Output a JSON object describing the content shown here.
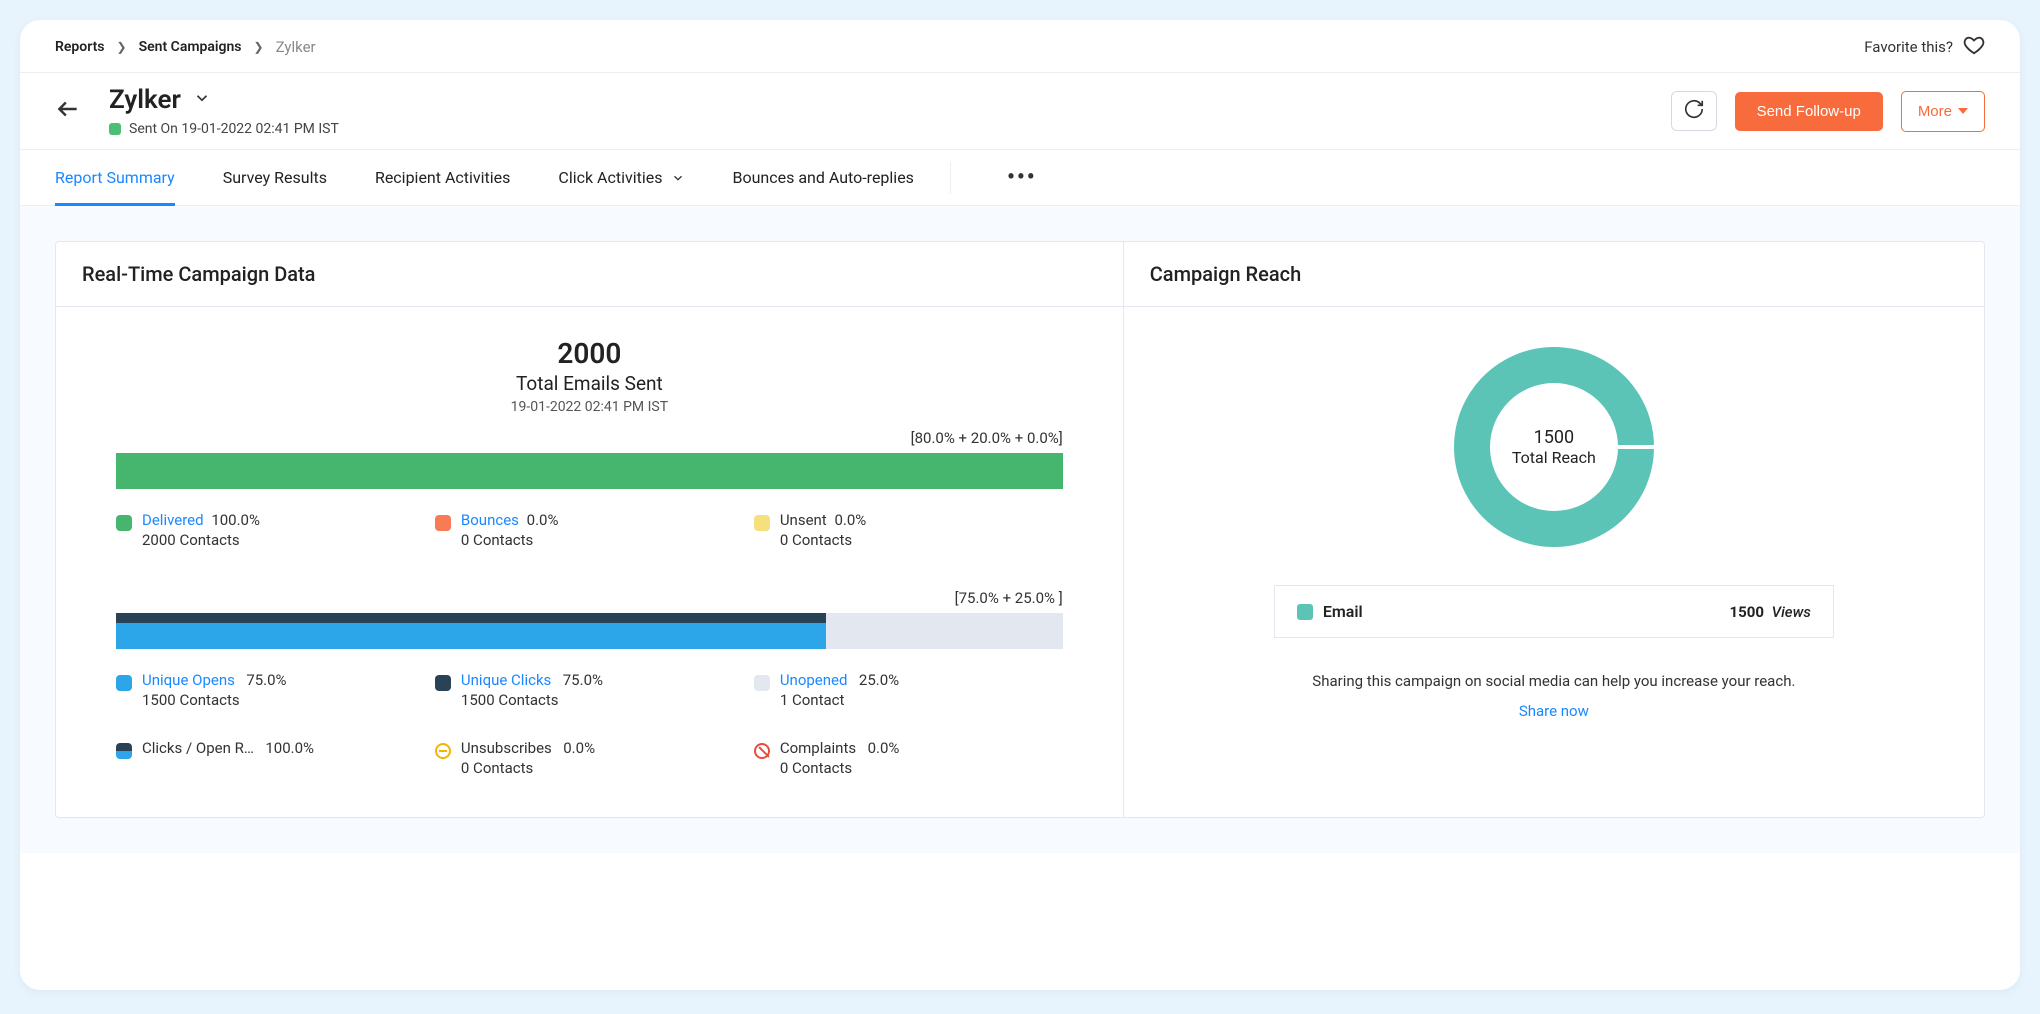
{
  "breadcrumb": {
    "root": "Reports",
    "mid": "Sent Campaigns",
    "current": "Zylker"
  },
  "favorite_label": "Favorite this?",
  "header": {
    "title": "Zylker",
    "sent_status_prefix": "Sent  On ",
    "sent_status_datetime": "19-01-2022 02:41 PM IST",
    "send_followup": "Send Follow-up",
    "more": "More"
  },
  "tabs": {
    "summary": "Report Summary",
    "survey": "Survey Results",
    "recipient": "Recipient Activities",
    "click": "Click Activities",
    "bounces": "Bounces and Auto-replies"
  },
  "realtime": {
    "title": "Real-Time Campaign Data",
    "total_value": "2000",
    "total_label": "Total Emails Sent",
    "total_date": "19-01-2022 02:41 PM IST",
    "bar1_caption": "[80.0% + 20.0% + 0.0%]",
    "bar2_caption": "[75.0% + 25.0% ]",
    "metrics": {
      "delivered": {
        "name": "Delivered",
        "pct": "100.0%",
        "contacts": "2000 Contacts"
      },
      "bounces": {
        "name": "Bounces",
        "pct": "0.0%",
        "contacts": "0 Contacts"
      },
      "unsent": {
        "name": "Unsent",
        "pct": "0.0%",
        "contacts": "0 Contacts"
      },
      "unique_opens": {
        "name": "Unique Opens",
        "pct": "75.0%",
        "contacts": "1500 Contacts"
      },
      "unique_clicks": {
        "name": "Unique Clicks",
        "pct": "75.0%",
        "contacts": "1500 Contacts"
      },
      "unopened": {
        "name": "Unopened",
        "pct": "25.0%",
        "contacts": "1 Contact"
      },
      "click_open": {
        "name": "Clicks / Open R…",
        "pct": "100.0%",
        "contacts": ""
      },
      "unsubscribes": {
        "name": "Unsubscribes",
        "pct": "0.0%",
        "contacts": "0 Contacts"
      },
      "complaints": {
        "name": "Complaints",
        "pct": "0.0%",
        "contacts": "0 Contacts"
      }
    }
  },
  "reach": {
    "title": "Campaign Reach",
    "donut_value": "1500",
    "donut_label": "Total Reach",
    "channel": "Email",
    "views_value": "1500",
    "views_word": "Views",
    "hint": "Sharing this campaign on social media can help you increase your reach.",
    "share": "Share now"
  },
  "chart_data": [
    {
      "type": "bar",
      "title": "Delivery breakdown",
      "categories": [
        "Delivered",
        "Bounces",
        "Unsent"
      ],
      "values_pct": [
        80.0,
        20.0,
        0.0
      ],
      "contacts": [
        2000,
        0,
        0
      ]
    },
    {
      "type": "bar",
      "title": "Engagement breakdown",
      "categories": [
        "Unique Opens / Clicks",
        "Unopened"
      ],
      "values_pct": [
        75.0,
        25.0
      ],
      "contacts": [
        1500,
        1
      ]
    },
    {
      "type": "pie",
      "title": "Campaign Reach",
      "categories": [
        "Email"
      ],
      "values": [
        1500
      ],
      "total": 1500
    }
  ]
}
